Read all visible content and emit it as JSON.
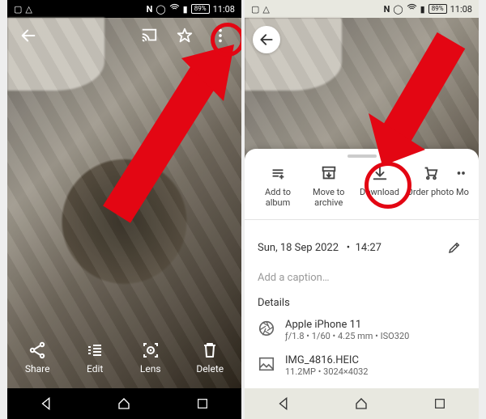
{
  "status": {
    "battery": "89%",
    "time": "11:08"
  },
  "left": {
    "actions": {
      "share": "Share",
      "edit": "Edit",
      "lens": "Lens",
      "delete": "Delete"
    }
  },
  "right": {
    "sheet": {
      "add_to_album": "Add to album",
      "move_to_archive_l1": "Move to",
      "move_to_archive_l2": "archive",
      "download": "Download",
      "order_photo": "Order photo",
      "more_clipped": "Mo"
    },
    "info": {
      "date": "Sun, 18 Sep 2022",
      "dot": "•",
      "time": "14:27",
      "caption_placeholder": "Add a caption…",
      "details_title": "Details",
      "device": "Apple iPhone 11",
      "device_meta": "ƒ/1.8  •  1/60  •  4.25 mm  •  ISO320",
      "filename": "IMG_4816.HEIC",
      "file_meta": "11.2MP  •  3024×4032"
    }
  }
}
